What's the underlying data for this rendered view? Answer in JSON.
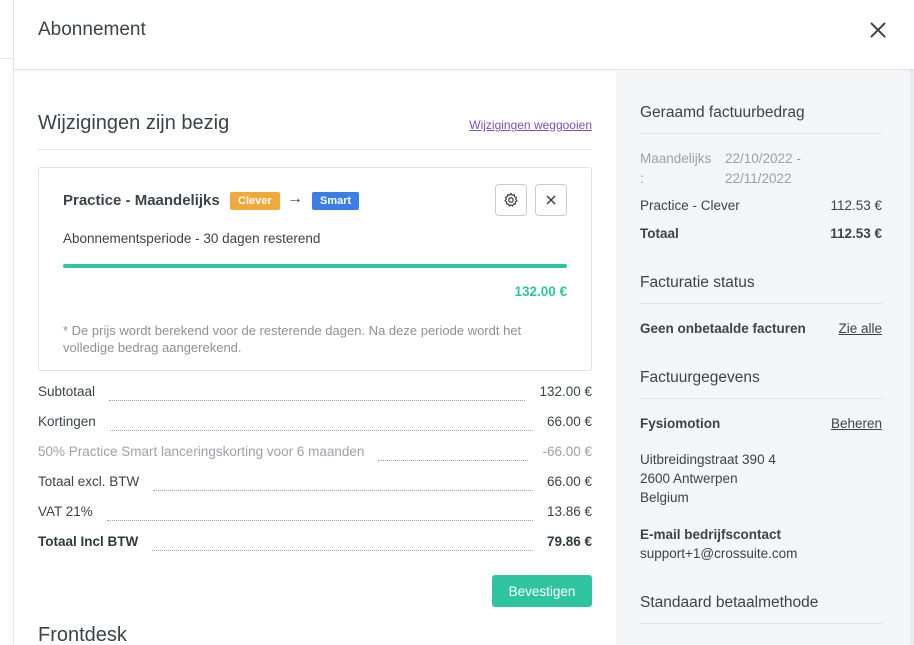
{
  "modal": {
    "title": "Abonnement"
  },
  "main": {
    "section_title": "Wijzigingen zijn bezig",
    "discard_link": "Wijzigingen weggooien",
    "card": {
      "plan_name": "Practice - Maandelijks",
      "from_plan": "Clever",
      "to_plan": "Smart",
      "arrow": "→",
      "period": "Abonnementsperiode - 30 dagen resterend",
      "progress": 1.0,
      "amount": "132.00 €",
      "note": "* De prijs wordt berekend voor de resterende dagen. Na deze periode wordt het volledige bedrag aangerekend."
    },
    "totals": [
      {
        "label": "Subtotaal",
        "value": "132.00 €",
        "style": "normal"
      },
      {
        "label": "Kortingen",
        "value": "66.00 €",
        "style": "normal"
      },
      {
        "label": "50% Practice Smart lanceringskorting voor 6 maanden",
        "value": "-66.00 €",
        "style": "muted"
      },
      {
        "label": "Totaal excl. BTW",
        "value": "66.00 €",
        "style": "normal"
      },
      {
        "label": "VAT 21%",
        "value": "13.86 €",
        "style": "normal"
      },
      {
        "label": "Totaal Incl BTW",
        "value": "79.86 €",
        "style": "bold"
      }
    ],
    "confirm_button": "Bevestigen",
    "next_section_title": "Frontdesk"
  },
  "aside": {
    "estimate_title": "Geraamd factuurbedrag",
    "period_label": "Maandelijks",
    "period_colon": ":",
    "period_start": "22/10/2022 -",
    "period_end": "22/11/2022",
    "line_label": "Practice - Clever",
    "line_value": "112.53 €",
    "total_label": "Totaal",
    "total_value": "112.53 €",
    "status_title": "Facturatie status",
    "status_text": "Geen onbetaalde facturen",
    "status_link": "Zie alle",
    "billing_title": "Factuurgegevens",
    "company": "Fysiomotion",
    "manage_link": "Beheren",
    "address_line1": "Uitbreidingstraat 390 4",
    "address_line2": "2600 Antwerpen",
    "address_line3": "Belgium",
    "email_label": "E-mail bedrijfscontact",
    "email": "support+1@crossuite.com",
    "payment_title": "Standaard betaalmethode"
  },
  "colors": {
    "accent": "#2ec4a0",
    "old_plan": "#f0a93b",
    "new_plan": "#3b7fe6",
    "link": "#7b4fbd"
  },
  "icons": {
    "close": "close-icon",
    "settings": "gear-icon",
    "remove": "x-icon",
    "arrow": "arrow-right-icon"
  }
}
